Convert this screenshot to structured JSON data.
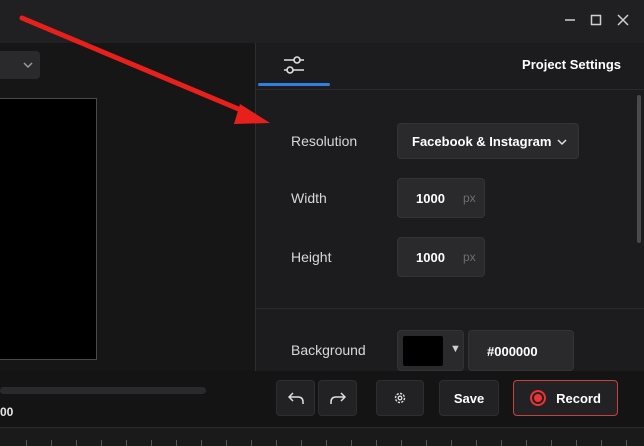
{
  "window": {
    "controls": {
      "minimize_icon": "minimize-icon",
      "maximize_icon": "maximize-icon",
      "close_icon": "close-icon"
    }
  },
  "left": {
    "dropdown_icon": "chevron-down-icon",
    "progress": 0,
    "time_text": "00"
  },
  "panel": {
    "tab_icon": "sliders-icon",
    "heading": "Project Settings",
    "resolution": {
      "label": "Resolution",
      "value": "Facebook & Instagram"
    },
    "width": {
      "label": "Width",
      "value": "1000",
      "unit": "px"
    },
    "height": {
      "label": "Height",
      "value": "1000",
      "unit": "px"
    },
    "background": {
      "label": "Background",
      "color": "#000000",
      "hex": "#000000"
    }
  },
  "toolbar": {
    "undo_icon": "undo-icon",
    "redo_icon": "redo-icon",
    "settings_icon": "gear-icon",
    "save_label": "Save",
    "record_label": "Record"
  },
  "colors": {
    "accent": "#2f7fe0",
    "record": "#e33333",
    "annotation_arrow": "#e8201c"
  }
}
